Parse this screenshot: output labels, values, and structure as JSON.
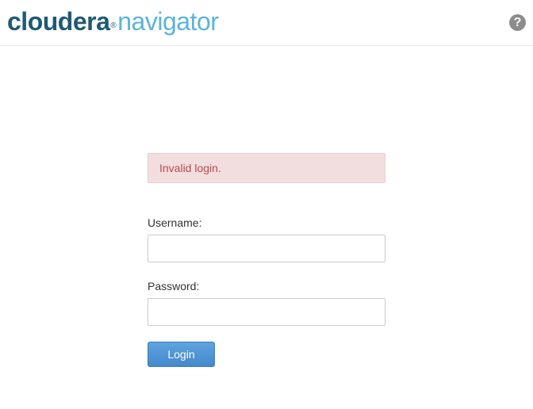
{
  "header": {
    "logo_brand": "cloudera",
    "logo_mark": "®",
    "logo_product": "navigator",
    "help_icon": "question-circle-icon",
    "help_glyph": "?"
  },
  "alert": {
    "message": "Invalid login.",
    "background": "#f2dede",
    "text_color": "#b94a48"
  },
  "login_form": {
    "username_label": "Username:",
    "username_value": "",
    "password_label": "Password:",
    "password_value": "",
    "login_button_label": "Login",
    "button_color": "#4a90d4"
  }
}
